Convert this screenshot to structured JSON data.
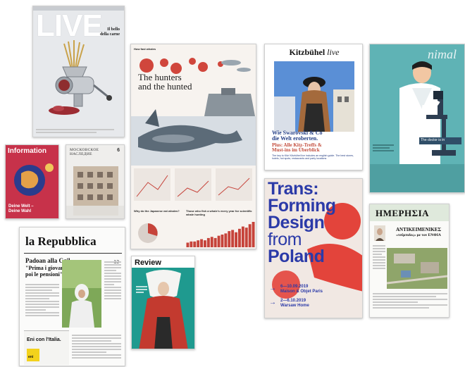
{
  "covers": {
    "live": {
      "masthead": "LIVE",
      "tagline_line1": "Il bello",
      "tagline_line2": "della carne"
    },
    "infographic": {
      "header": "How fast whales",
      "title_line1": "The hunters",
      "title_line2": "and the hunted",
      "bottom_left": "Why do the Japanese eat whales?",
      "bottom_right": "Those who fish a whale's every year for scientific whale hunting"
    },
    "kitzbuhel": {
      "masthead_a": "Kitzbühel",
      "masthead_b": "live",
      "headline1": "Wie Swarovski & Co",
      "headline2": "die Welt eroberten.",
      "plus": "Plus: Alle Kitz-Treffs &",
      "plus2": "Must-ins im Überblick",
      "body": "The key to Kitz! Kitzbühel live includes an english guide. The best stores, hotels, hot spots, restaurants and party locations"
    },
    "animal": {
      "masthead": "nimal",
      "caption": "The doctor is in"
    },
    "information": {
      "masthead": "Information",
      "footer_line1": "Deine Welt –",
      "footer_line2": "Deine Wahl"
    },
    "moskovskoe": {
      "masthead_line1": "МОСКОВСКОЕ",
      "masthead_line2": "НАСЛЕДИЕ",
      "issue": "6"
    },
    "trans": {
      "line1": "Trans:",
      "line2": "Forming",
      "line3": "Design",
      "line4": "from",
      "line5": "Poland",
      "date1": "6—10.09.2019",
      "venue1": "Maison & Objet Paris",
      "date2": "2—6.10.2019",
      "venue2": "Warsaw Home"
    },
    "repubblica": {
      "masthead": "la Repubblica",
      "headline": "Padoan alla Cgil",
      "sub1": "\"Prima i giovani",
      "sub2": "poi le pensioni\"",
      "ad": "Eni con l'Italia.",
      "logo": "eni",
      "date": "13"
    },
    "review": {
      "masthead": "Review"
    },
    "imerisia": {
      "masthead": "ΗΜΕΡΗΣΙΑ",
      "headline1": "ΑΝΤΙΚΕΙΜΕΝΙΚΕΣ",
      "headline2": "«τσίμπιδες» με τον ΕΝΦΙΑ"
    }
  },
  "colors": {
    "trans_red": "#e3443b",
    "trans_blue": "#2b3aa8",
    "trans_bg": "#f1e8e3",
    "animal_bg": "#5fb3b5",
    "information_bg": "#c7324a",
    "review_green": "#1f9a8f",
    "review_red": "#c33a2f"
  },
  "chart_data": {
    "type": "bar",
    "values": [
      4,
      5,
      5,
      6,
      7,
      6,
      8,
      9,
      8,
      10,
      11,
      12,
      14,
      15,
      13,
      16,
      18,
      17,
      20,
      22
    ]
  }
}
